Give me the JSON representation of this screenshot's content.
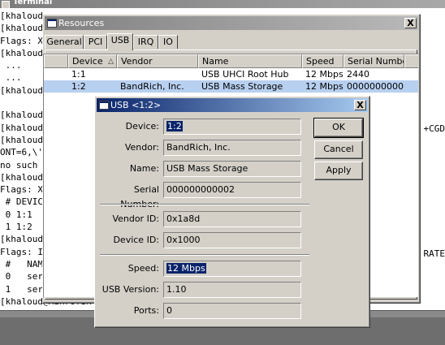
{
  "terminal": {
    "title": "Terminal",
    "lines": [
      "[khaloud",
      "[khaloud",
      "Flags: X",
      "[khaloud",
      " ...",
      " ...",
      "[khaloud",
      "",
      "[khaloud",
      "[khaloud",
      "[khaloud",
      "ONT=6,\\'",
      "no such",
      "[khaloud",
      "Flags: X",
      " # DEVIC",
      " 0 1:1",
      " 1 1:2",
      "[khaloud",
      "Flags: I",
      " #   NAM",
      " 0   ser",
      " 1   ser",
      "[khaloud@MikroTik"
    ],
    "right_fragments": {
      "cgd": "+CGD",
      "rate": "RATE"
    }
  },
  "resources": {
    "title": "Resources",
    "close_label": "X",
    "tabs": [
      {
        "label": "General"
      },
      {
        "label": "PCI"
      },
      {
        "label": "USB"
      },
      {
        "label": "IRQ"
      },
      {
        "label": "IO"
      }
    ],
    "active_tab": "USB",
    "columns": [
      "Device",
      "Vendor",
      "Name",
      "Speed",
      "Serial Number"
    ],
    "sort_indicator": "△",
    "rows": [
      {
        "device": "1:1",
        "vendor": "",
        "name": "USB UHCI Root Hub",
        "speed": "12 Mbps",
        "serial": "2440"
      },
      {
        "device": "1:2",
        "vendor": "BandRich, Inc.",
        "name": "USB Mass Storage",
        "speed": "12 Mbps",
        "serial": "0000000000..."
      }
    ]
  },
  "usb_dialog": {
    "title": "USB <1:2>",
    "close_label": "X",
    "fields": {
      "device_label": "Device:",
      "device_value": "1:2",
      "vendor_label": "Vendor:",
      "vendor_value": "BandRich, Inc.",
      "name_label": "Name:",
      "name_value": "USB Mass Storage",
      "serial_label": "Serial Number:",
      "serial_value": "000000000002",
      "vendor_id_label": "Vendor ID:",
      "vendor_id_value": "0x1a8d",
      "device_id_label": "Device ID:",
      "device_id_value": "0x1000",
      "speed_label": "Speed:",
      "speed_value": "12 Mbps",
      "usb_version_label": "USB Version:",
      "usb_version_value": "1.10",
      "ports_label": "Ports:",
      "ports_value": "0"
    },
    "buttons": {
      "ok": "OK",
      "cancel": "Cancel",
      "apply": "Apply"
    }
  },
  "colors": {
    "active_title": "#0a246a",
    "inactive_title": "#808080",
    "selected_row": "#b8d0f0",
    "window_face": "#d4d0c8"
  }
}
